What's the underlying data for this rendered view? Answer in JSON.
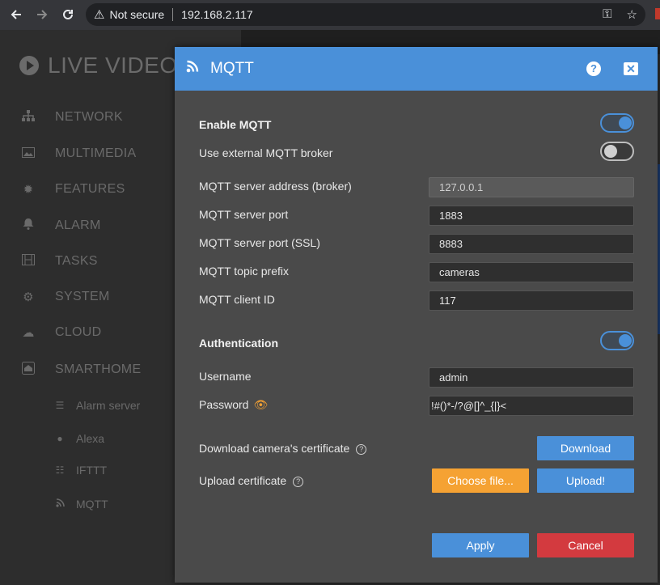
{
  "browser": {
    "security_label": "Not secure",
    "url": "192.168.2.117"
  },
  "app": {
    "logo_text": "LIVE VIDEO"
  },
  "sidebar": {
    "items": [
      {
        "label": "NETWORK",
        "icon": "network-icon"
      },
      {
        "label": "MULTIMEDIA",
        "icon": "image-icon"
      },
      {
        "label": "FEATURES",
        "icon": "gear-badge-icon"
      },
      {
        "label": "ALARM",
        "icon": "bell-icon"
      },
      {
        "label": "TASKS",
        "icon": "film-icon"
      },
      {
        "label": "SYSTEM",
        "icon": "cog-icon"
      },
      {
        "label": "CLOUD",
        "icon": "cloud-icon"
      },
      {
        "label": "SMARTHOME",
        "icon": "home-icon"
      }
    ],
    "subitems": [
      {
        "label": "Alarm server",
        "icon": "server-icon"
      },
      {
        "label": "Alexa",
        "icon": "chat-icon"
      },
      {
        "label": "IFTTT",
        "icon": "list-icon"
      },
      {
        "label": "MQTT",
        "icon": "rss-icon"
      }
    ]
  },
  "modal": {
    "title": "MQTT",
    "enable_mqtt": {
      "label": "Enable MQTT",
      "on": true
    },
    "external_broker": {
      "label": "Use external MQTT broker",
      "on": false
    },
    "server_address": {
      "label": "MQTT server address (broker)",
      "value": "127.0.0.1"
    },
    "server_port": {
      "label": "MQTT server port",
      "value": "1883"
    },
    "server_port_ssl": {
      "label": "MQTT server port (SSL)",
      "value": "8883"
    },
    "topic_prefix": {
      "label": "MQTT topic prefix",
      "value": "cameras"
    },
    "client_id": {
      "label": "MQTT client ID",
      "value": "117"
    },
    "authentication": {
      "label": "Authentication",
      "on": true
    },
    "username": {
      "label": "Username",
      "value": "admin"
    },
    "password": {
      "label": "Password",
      "value": "!#()*-/?@[]^_{|}<"
    },
    "download_cert": {
      "label": "Download camera's certificate",
      "button": "Download"
    },
    "upload_cert": {
      "label": "Upload certificate",
      "choose_button": "Choose file...",
      "upload_button": "Upload!"
    },
    "apply_button": "Apply",
    "cancel_button": "Cancel"
  },
  "colors": {
    "accent": "#4a90d9",
    "orange": "#f5a233",
    "danger": "#d33a3f"
  }
}
